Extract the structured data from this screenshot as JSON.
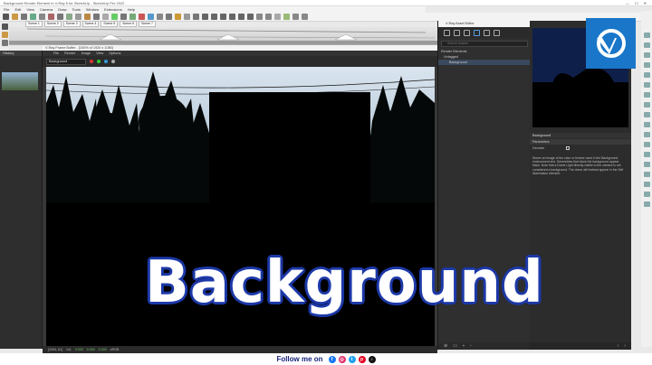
{
  "window": {
    "title": "Background Render Element in V-Ray 6 for SketchUp - SketchUp Pro 2022",
    "controls": [
      "—",
      "☐",
      "✕"
    ]
  },
  "menu": [
    "File",
    "Edit",
    "View",
    "Camera",
    "Draw",
    "Tools",
    "Window",
    "Extensions",
    "Help"
  ],
  "scene_tabs": [
    "Scene 1",
    "Scene 2",
    "Scene 3",
    "Scene 4",
    "Scene 5",
    "Scene 6",
    "Scene 7"
  ],
  "history": {
    "label": "History"
  },
  "vfb": {
    "title": "V-Ray Frame Buffer - [100% of 1920 x 1080]",
    "menu": [
      "File",
      "Render",
      "Image",
      "View",
      "Options"
    ],
    "channel": "Background",
    "status": {
      "coords": "[1094, 61]",
      "mode": "1x1",
      "values": [
        "0.000",
        "0.000",
        "0.000"
      ],
      "extra": [
        "sRGB"
      ]
    }
  },
  "asset_editor": {
    "title": "V-Ray Asset Editor",
    "search_placeholder": "Search Assets",
    "list": {
      "header": "Render Elements",
      "group": "Untagged",
      "item": "Background"
    }
  },
  "properties": {
    "header": "Background",
    "section": "Parameters",
    "enabled_label": "Denoise",
    "description": "Stores an image of the color or texture used in the Background environment slot. Geometries that block the background appear black. Note that a Dome Light directly visible to the camera is not considered a background. The dome will instead appear in the Self Illumination element."
  },
  "overlay": {
    "title": "Background"
  },
  "follow": {
    "text": "Follow me on",
    "icons": [
      "facebook-icon",
      "instagram-icon",
      "twitter-icon",
      "pinterest-icon",
      "tiktok-icon"
    ],
    "colors": {
      "facebook": "#1877f2",
      "instagram": "#e1306c",
      "twitter": "#1da1f2",
      "pinterest": "#e60023",
      "tiktok": "#111111"
    }
  },
  "colors": {
    "accent": "#1976c9",
    "title_outline": "#1e3aa8"
  }
}
